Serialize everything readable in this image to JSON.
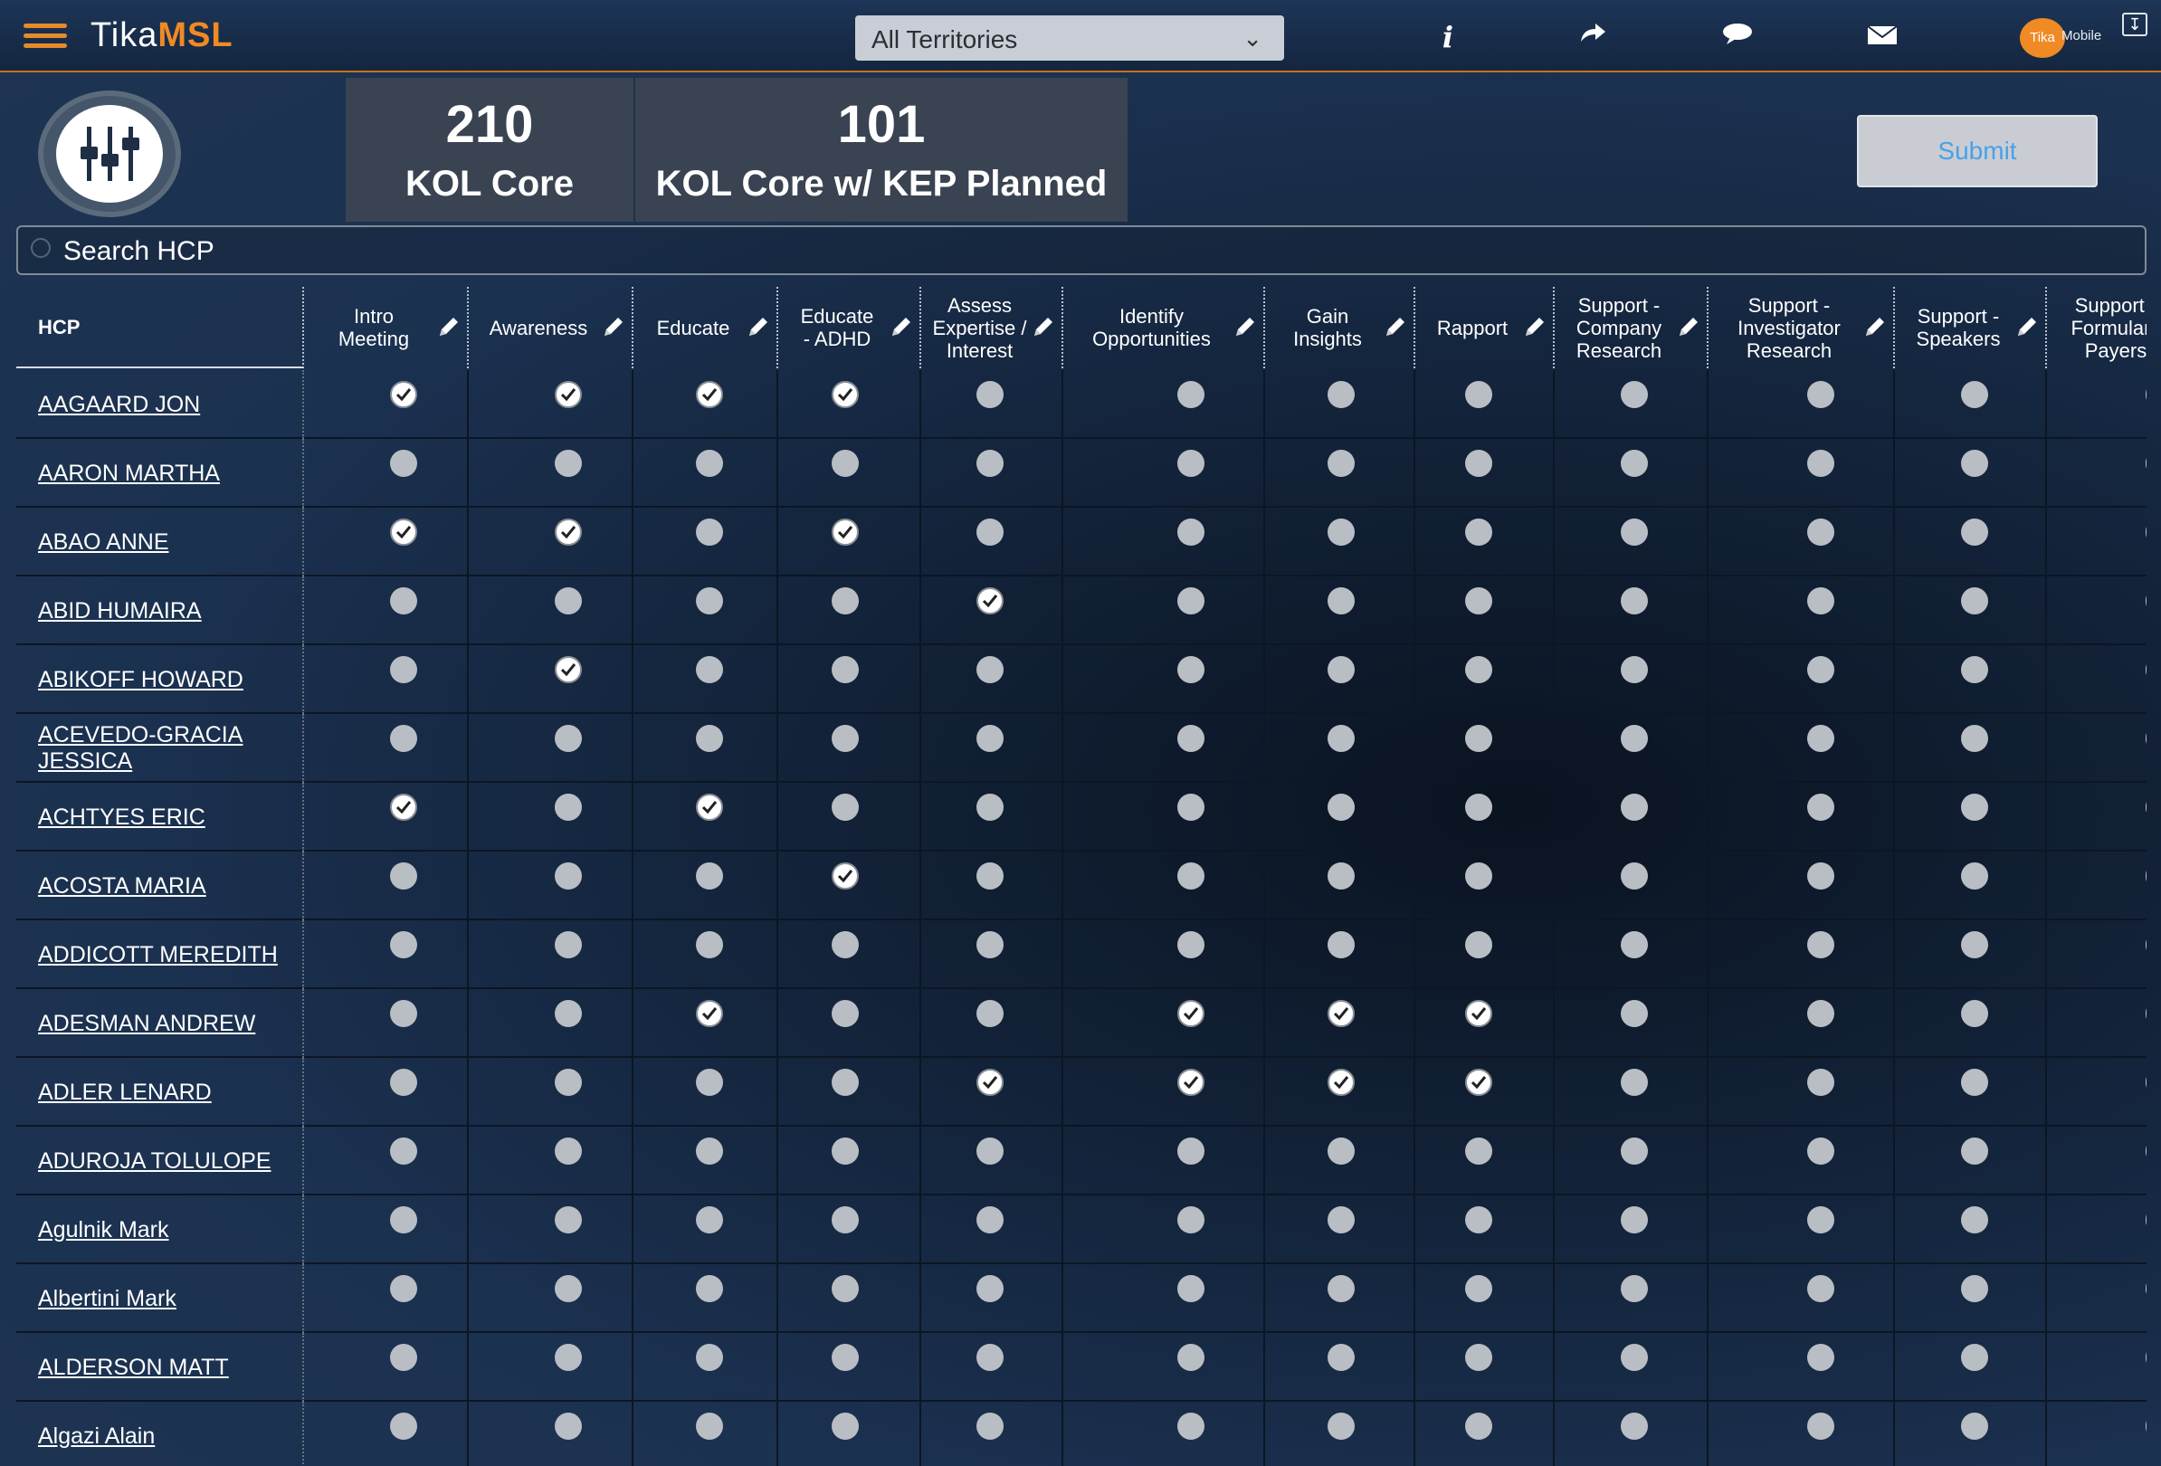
{
  "app": {
    "logo_tika": "Tika",
    "logo_msl": "MSL"
  },
  "topbar": {
    "territory_label": "All Territories",
    "info_icon": "info-icon",
    "share_icon": "share-arrow-icon",
    "chat_icon": "chat-bubble-icon",
    "mail_icon": "envelope-icon",
    "avatar_label": "Tika",
    "avatar_suffix": "Mobile",
    "download_icon": "download-icon"
  },
  "kpis": [
    {
      "value": "210",
      "label": "KOL Core"
    },
    {
      "value": "101",
      "label": "KOL Core w/ KEP Planned"
    }
  ],
  "submit_label": "Submit",
  "search": {
    "placeholder": "Search HCP"
  },
  "colors": {
    "accent": "#f08a24",
    "submit_text": "#4aa0e6",
    "kpi_bg": "#3a4351"
  },
  "columns": [
    {
      "label": "HCP"
    },
    {
      "label": "Intro Meeting"
    },
    {
      "label": "Awareness"
    },
    {
      "label": "Educate"
    },
    {
      "label": "Educate - ADHD"
    },
    {
      "label": "Assess Expertise / Interest"
    },
    {
      "label": "Identify Opportunities"
    },
    {
      "label": "Gain Insights"
    },
    {
      "label": "Rapport"
    },
    {
      "label": "Support - Company Research"
    },
    {
      "label": "Support - Investigator Research"
    },
    {
      "label": "Support - Speakers"
    },
    {
      "label": "Support - Formulary Payers"
    }
  ],
  "rows": [
    {
      "name": "AAGAARD JON",
      "checks": [
        1,
        1,
        1,
        1,
        0,
        0,
        0,
        0,
        0,
        0,
        0
      ]
    },
    {
      "name": "AARON MARTHA",
      "checks": [
        0,
        0,
        0,
        0,
        0,
        0,
        0,
        0,
        0,
        0,
        0
      ]
    },
    {
      "name": "ABAO ANNE",
      "checks": [
        1,
        1,
        0,
        1,
        0,
        0,
        0,
        0,
        0,
        0,
        0
      ]
    },
    {
      "name": "ABID HUMAIRA",
      "checks": [
        0,
        0,
        0,
        0,
        1,
        0,
        0,
        0,
        0,
        0,
        0
      ]
    },
    {
      "name": "ABIKOFF HOWARD",
      "checks": [
        0,
        1,
        0,
        0,
        0,
        0,
        0,
        0,
        0,
        0,
        0
      ]
    },
    {
      "name": "ACEVEDO-GRACIA JESSICA",
      "checks": [
        0,
        0,
        0,
        0,
        0,
        0,
        0,
        0,
        0,
        0,
        0
      ]
    },
    {
      "name": "ACHTYES ERIC",
      "checks": [
        1,
        0,
        1,
        0,
        0,
        0,
        0,
        0,
        0,
        0,
        0
      ]
    },
    {
      "name": "ACOSTA MARIA",
      "checks": [
        0,
        0,
        0,
        1,
        0,
        0,
        0,
        0,
        0,
        0,
        0
      ]
    },
    {
      "name": "ADDICOTT MEREDITH",
      "checks": [
        0,
        0,
        0,
        0,
        0,
        0,
        0,
        0,
        0,
        0,
        0
      ]
    },
    {
      "name": "ADESMAN ANDREW",
      "checks": [
        0,
        0,
        1,
        0,
        0,
        1,
        1,
        1,
        0,
        0,
        0
      ]
    },
    {
      "name": "ADLER LENARD",
      "checks": [
        0,
        0,
        0,
        0,
        1,
        1,
        1,
        1,
        0,
        0,
        0
      ]
    },
    {
      "name": "ADUROJA TOLULOPE",
      "checks": [
        0,
        0,
        0,
        0,
        0,
        0,
        0,
        0,
        0,
        0,
        0
      ]
    },
    {
      "name": "Agulnik Mark",
      "checks": [
        0,
        0,
        0,
        0,
        0,
        0,
        0,
        0,
        0,
        0,
        0
      ]
    },
    {
      "name": "Albertini Mark",
      "checks": [
        0,
        0,
        0,
        0,
        0,
        0,
        0,
        0,
        0,
        0,
        0
      ]
    },
    {
      "name": "ALDERSON MATT",
      "checks": [
        0,
        0,
        0,
        0,
        0,
        0,
        0,
        0,
        0,
        0,
        0
      ]
    },
    {
      "name": "Algazi Alain",
      "checks": [
        0,
        0,
        0,
        0,
        0,
        0,
        0,
        0,
        0,
        0,
        0
      ]
    }
  ]
}
